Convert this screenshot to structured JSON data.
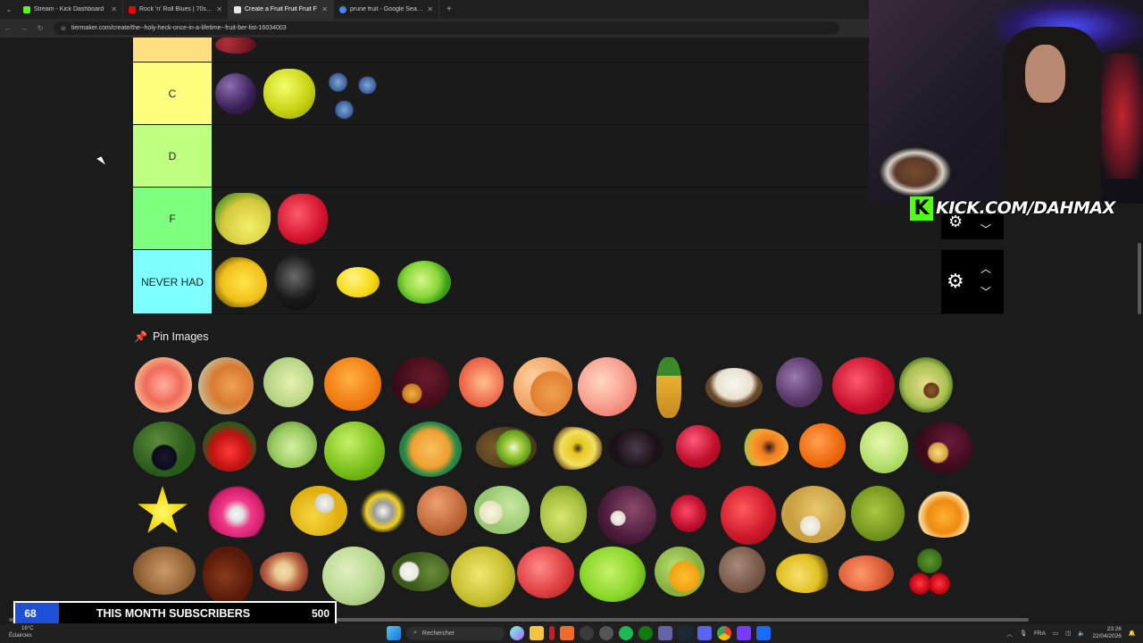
{
  "browser": {
    "tabs": [
      {
        "title": "Stream - Kick Dashboard",
        "color": "#53fc18"
      },
      {
        "title": "Rock 'n' Roll Blues | 70s Su",
        "color": "#ff0000"
      },
      {
        "title": "Create a Fruit Fruit Fruit F",
        "color": "#e8e8e8"
      },
      {
        "title": "prune fruit - Google Search",
        "color": "#4285f4"
      }
    ],
    "url": "tiermaker.com/create/the--holy-heck-once-in-a-lifetime--fruit-ber-list-16034003"
  },
  "tiers": [
    {
      "label": "",
      "color": "#ffdf80"
    },
    {
      "label": "C",
      "color": "#ffff7f"
    },
    {
      "label": "D",
      "color": "#bfff7f"
    },
    {
      "label": "F",
      "color": "#7fff7f"
    },
    {
      "label": "NEVER HAD",
      "color": "#7fffff"
    }
  ],
  "pin_images": {
    "title": "Pin Images"
  },
  "stream": {
    "brand": "KICK.COM/DAHMAX",
    "subscribers_label": "THIS MONTH SUBSCRIBERS",
    "subscribers_current": "68",
    "subscribers_goal": "500",
    "subscribers_progress": 0.136
  },
  "taskbar": {
    "weather_temp": "16°C",
    "weather_desc": "Éclaircies",
    "search_placeholder": "Rechercher",
    "lang": "FRA",
    "time": "23:26",
    "date": "22/04/2026"
  }
}
